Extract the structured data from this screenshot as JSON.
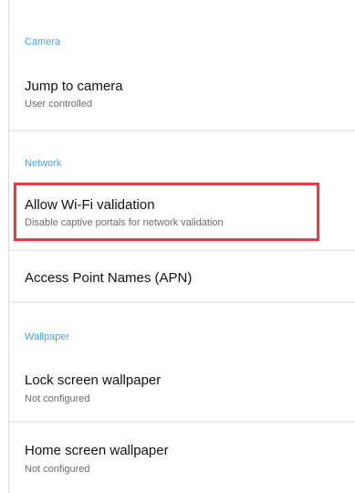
{
  "sections": {
    "camera": {
      "title": "Camera",
      "jump_to_camera": {
        "title": "Jump to camera",
        "subtitle": "User controlled"
      }
    },
    "network": {
      "title": "Network",
      "wifi_validation": {
        "title": "Allow Wi-Fi validation",
        "subtitle": "Disable captive portals for network validation"
      },
      "apn": {
        "title": "Access Point Names (APN)"
      }
    },
    "wallpaper": {
      "title": "Wallpaper",
      "lock_screen": {
        "title": "Lock screen wallpaper",
        "subtitle": "Not configured"
      },
      "home_screen": {
        "title": "Home screen wallpaper",
        "subtitle": "Not configured"
      }
    }
  },
  "colors": {
    "section_title": "#3da3e8",
    "highlight_border": "#e43b44",
    "divider": "#ececec"
  }
}
